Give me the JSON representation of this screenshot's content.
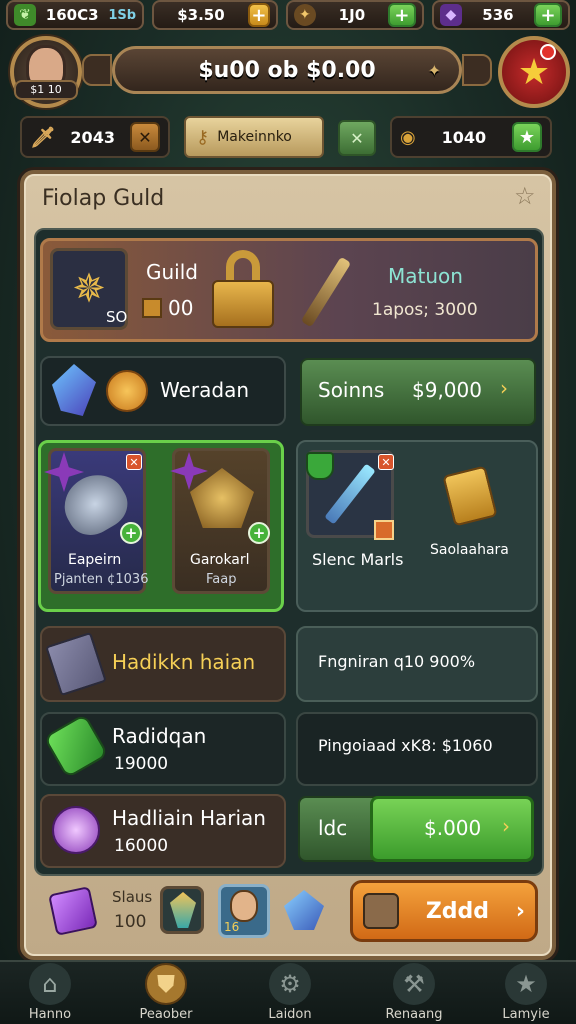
{
  "resources": [
    {
      "value": "160C3",
      "currency_label": "1Sb",
      "icon": "leaf-icon",
      "color": "#5fbf3a"
    },
    {
      "value": "$3.50",
      "icon": "coin-icon",
      "color": "#d9a33a"
    },
    {
      "value": "1J0",
      "icon": "compass-icon",
      "color": "#c8893a"
    },
    {
      "value": "536",
      "icon": "crystal-icon",
      "color": "#9a5bd8"
    }
  ],
  "header": {
    "title": "$u00 ob $0.00",
    "avatar_tag": "$1 10"
  },
  "secondary": {
    "sword_value": "2043",
    "craft_label": "Makeinnko",
    "gold_value": "1040"
  },
  "panel": {
    "title": "Fiolap Guld",
    "guild": {
      "label": "Guild",
      "count": "00",
      "slot_tag": "SO",
      "item_name": "Matuon",
      "price": "1apos; 3000"
    },
    "row2": {
      "label": "Weradan",
      "action_label": "Soinns",
      "action_price": "$9,000"
    },
    "items": [
      {
        "name": "Eapeirn",
        "sub": "Pjanten ¢1036"
      },
      {
        "name": "Garokarl",
        "sub": "Faap"
      },
      {
        "name": "Slenc Marls",
        "sub": ""
      },
      {
        "name": "Saolaahara",
        "sub": ""
      }
    ],
    "offers": [
      {
        "name": "Hadikkn haian",
        "value": "",
        "info": "Fngniran q10 900%"
      },
      {
        "name": "Radidqan",
        "value": "19000",
        "info": "Pingoiaad xK8: $1060"
      },
      {
        "name": "Hadliain Harian",
        "value": "16000",
        "button_tag": "ldc",
        "button_price": "$.000"
      }
    ],
    "footer": {
      "label": "Slaus",
      "value": "100",
      "hero_tag": "16",
      "chest_label": "Zddd"
    }
  },
  "nav": [
    {
      "label": "Hanno",
      "icon": "home-icon"
    },
    {
      "label": "Peaober",
      "icon": "shield-icon"
    },
    {
      "label": "Laidon",
      "icon": "gear-icon"
    },
    {
      "label": "Renaang",
      "icon": "hammer-icon"
    },
    {
      "label": "Lamyie",
      "icon": "star-icon"
    }
  ],
  "colors": {
    "accent_green": "#4fb23b",
    "gold": "#f5cf56",
    "panel": "#d6c4a4",
    "orange": "#e5862a"
  }
}
